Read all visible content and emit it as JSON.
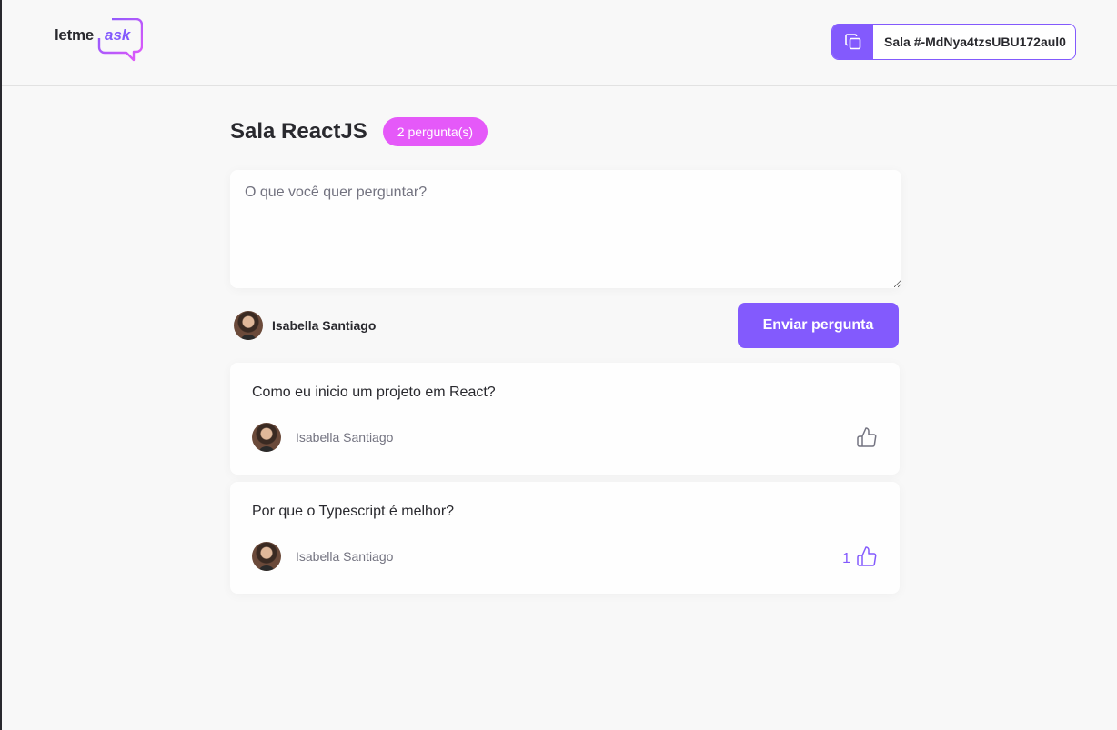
{
  "header": {
    "logo": {
      "letme": "letme",
      "ask": "ask"
    },
    "room_code": {
      "label": "Sala #-MdNya4tzsUBU172aul0"
    }
  },
  "room": {
    "title": "Sala ReactJS",
    "badge": "2 pergunta(s)"
  },
  "form": {
    "placeholder": "O que você quer perguntar?",
    "value": "",
    "user_name": "Isabella Santiago",
    "send_label": "Enviar pergunta"
  },
  "questions": [
    {
      "content": "Como eu inicio um projeto em React?",
      "author": "Isabella Santiago",
      "like_count": "",
      "liked": false
    },
    {
      "content": "Por que o Typescript é melhor?",
      "author": "Isabella Santiago",
      "like_count": "1",
      "liked": true
    }
  ],
  "colors": {
    "accent": "#835afd",
    "badge": "#e559f9",
    "text": "#29292e",
    "muted": "#737380",
    "background": "#f8f8f8"
  },
  "icons": {
    "copy": "copy-icon",
    "like": "thumbs-up-icon",
    "logo": "speech-bubble-logo"
  }
}
